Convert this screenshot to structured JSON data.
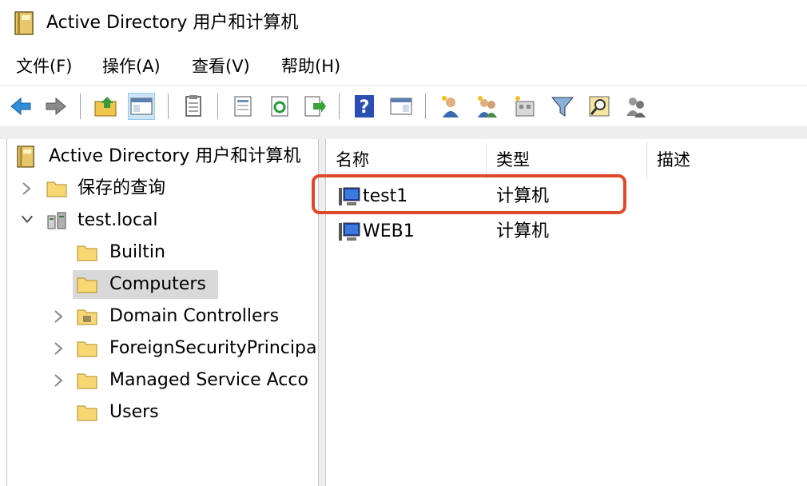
{
  "window": {
    "title": "Active Directory 用户和计算机"
  },
  "menu": [
    "文件(F)",
    "操作(A)",
    "查看(V)",
    "帮助(H)"
  ],
  "toolbar": {
    "buttons": [
      "back-icon",
      "forward-icon",
      "up-folder-icon",
      "show-hide-console-tree-icon",
      "copy-icon",
      "properties-icon",
      "refresh-icon",
      "export-list-icon",
      "help-icon",
      "show-action-pane-icon",
      "new-user-icon",
      "new-group-icon",
      "new-ou-icon",
      "filter-icon",
      "find-icon",
      "add-to-group-icon"
    ]
  },
  "tree": {
    "root": "Active Directory 用户和计算机",
    "saved_queries": "保存的查询",
    "domain": "test.local",
    "children": [
      "Builtin",
      "Computers",
      "Domain Controllers",
      "ForeignSecurityPrincipa",
      "Managed Service Acco",
      "Users"
    ],
    "selected": "Computers"
  },
  "list": {
    "columns": [
      "名称",
      "类型",
      "描述"
    ],
    "rows": [
      {
        "name": "test1",
        "type": "计算机",
        "description": ""
      },
      {
        "name": "WEB1",
        "type": "计算机",
        "description": ""
      }
    ],
    "highlighted_row": "test1",
    "highlight_color": "#e0482c"
  }
}
